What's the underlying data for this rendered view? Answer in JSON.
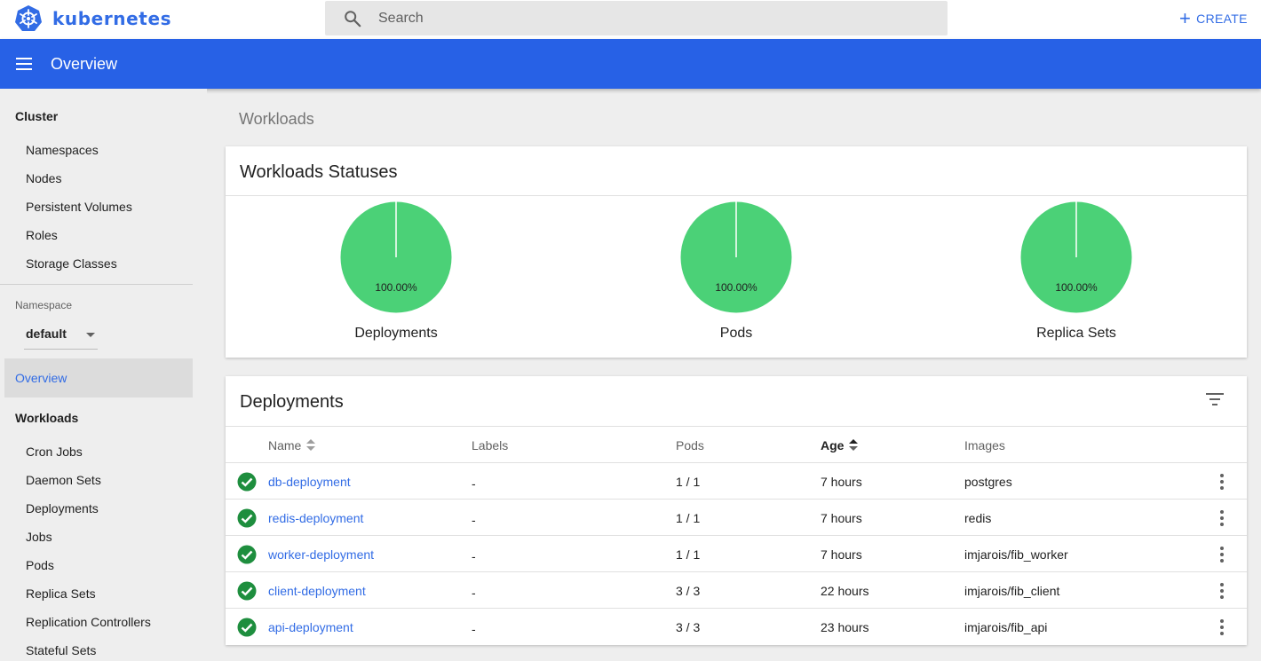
{
  "topbar": {
    "brand": "kubernetes",
    "search_placeholder": "Search",
    "create_label": "CREATE"
  },
  "header": {
    "title": "Overview"
  },
  "sidebar": {
    "cluster_title": "Cluster",
    "cluster_items": [
      "Namespaces",
      "Nodes",
      "Persistent Volumes",
      "Roles",
      "Storage Classes"
    ],
    "namespace_label": "Namespace",
    "namespace_value": "default",
    "overview_label": "Overview",
    "workloads_title": "Workloads",
    "workloads_items": [
      "Cron Jobs",
      "Daemon Sets",
      "Deployments",
      "Jobs",
      "Pods",
      "Replica Sets",
      "Replication Controllers",
      "Stateful Sets"
    ]
  },
  "main": {
    "breadcrumb": "Workloads",
    "statuses": {
      "title": "Workloads Statuses",
      "charts": [
        {
          "label": "Deployments",
          "percent": "100.00%",
          "running_fraction": 1.0
        },
        {
          "label": "Pods",
          "percent": "100.00%",
          "running_fraction": 1.0
        },
        {
          "label": "Replica Sets",
          "percent": "100.00%",
          "running_fraction": 1.0
        }
      ],
      "color_running": "#4bd177"
    },
    "deployments": {
      "title": "Deployments",
      "columns": [
        "Name",
        "Labels",
        "Pods",
        "Age",
        "Images"
      ],
      "rows": [
        {
          "name": "db-deployment",
          "labels": "-",
          "pods": "1 / 1",
          "age": "7 hours",
          "images": "postgres"
        },
        {
          "name": "redis-deployment",
          "labels": "-",
          "pods": "1 / 1",
          "age": "7 hours",
          "images": "redis"
        },
        {
          "name": "worker-deployment",
          "labels": "-",
          "pods": "1 / 1",
          "age": "7 hours",
          "images": "imjarois/fib_worker"
        },
        {
          "name": "client-deployment",
          "labels": "-",
          "pods": "3 / 3",
          "age": "22 hours",
          "images": "imjarois/fib_client"
        },
        {
          "name": "api-deployment",
          "labels": "-",
          "pods": "3 / 3",
          "age": "23 hours",
          "images": "imjarois/fib_api"
        }
      ]
    }
  },
  "colors": {
    "accent": "#326ce5",
    "header": "#2761e6",
    "success": "#1e8e3e"
  }
}
